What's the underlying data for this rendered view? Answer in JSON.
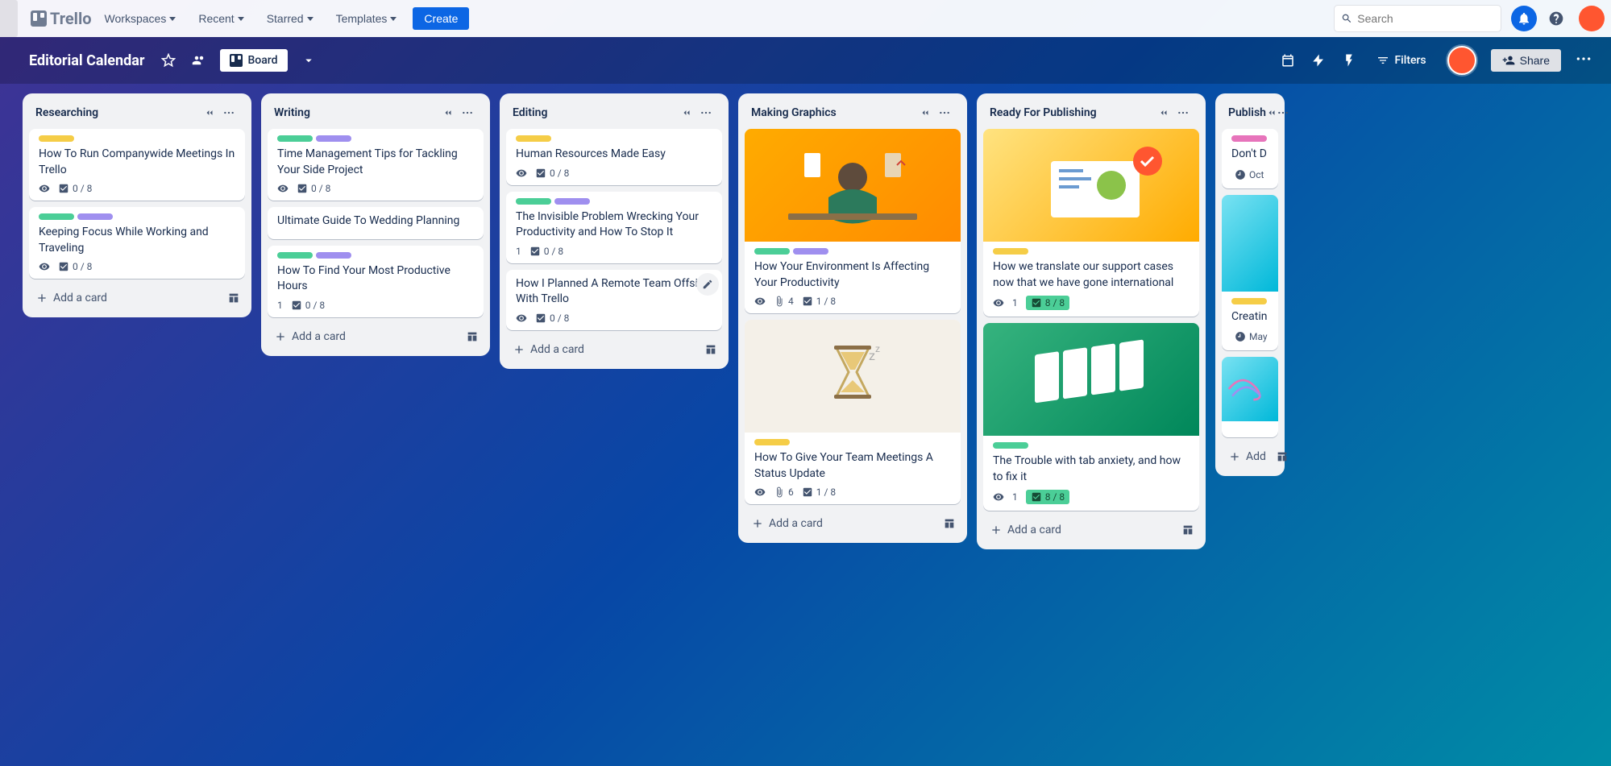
{
  "nav": {
    "logo_text": "Trello",
    "workspaces": "Workspaces",
    "recent": "Recent",
    "starred": "Starred",
    "templates": "Templates",
    "create": "Create",
    "search_placeholder": "Search"
  },
  "board_header": {
    "name": "Editorial Calendar",
    "board_view": "Board",
    "filters": "Filters",
    "share": "Share"
  },
  "lists": [
    {
      "title": "Researching",
      "add_card": "Add a card",
      "cards": [
        {
          "labels": [
            "yellow"
          ],
          "title": "How To Run Companywide Meetings In Trello",
          "badges": {
            "eye": true,
            "checklist": "0 / 8"
          }
        },
        {
          "labels": [
            "green",
            "purple"
          ],
          "title": "Keeping Focus While Working and Traveling",
          "badges": {
            "eye": true,
            "checklist": "0 / 8"
          }
        }
      ]
    },
    {
      "title": "Writing",
      "add_card": "Add a card",
      "cards": [
        {
          "labels": [
            "green",
            "purple"
          ],
          "title": "Time Management Tips for Tackling Your Side Project",
          "badges": {
            "eye": true,
            "checklist": "0 / 8"
          }
        },
        {
          "labels": [],
          "title": "Ultimate Guide To Wedding Planning",
          "badges": {}
        },
        {
          "labels": [
            "green",
            "purple"
          ],
          "title": "How To Find Your Most Productive Hours",
          "badges": {
            "num": "1",
            "checklist": "0 / 8"
          }
        }
      ]
    },
    {
      "title": "Editing",
      "add_card": "Add a card",
      "cards": [
        {
          "labels": [
            "yellow"
          ],
          "title": "Human Resources Made Easy",
          "badges": {
            "eye": true,
            "checklist": "0 / 8"
          }
        },
        {
          "labels": [
            "green",
            "purple"
          ],
          "title": "The Invisible Problem Wrecking Your Productivity and How To Stop It",
          "badges": {
            "num": "1",
            "checklist": "0 / 8"
          }
        },
        {
          "labels": [],
          "title": "How I Planned A Remote Team Offsite With Trello",
          "badges": {
            "eye": true,
            "checklist": "0 / 8"
          },
          "edit_icon": true
        }
      ]
    },
    {
      "title": "Making Graphics",
      "add_card": "Add a card",
      "cards": [
        {
          "cover": "orange-meditate",
          "labels": [
            "green",
            "purple"
          ],
          "title": "How Your Environment Is Affecting Your Productivity",
          "badges": {
            "eye": true,
            "attach": "4",
            "checklist": "1 / 8"
          }
        },
        {
          "cover": "hourglass",
          "labels": [
            "yellow"
          ],
          "title": "How To Give Your Team Meetings A Status Update",
          "badges": {
            "eye": true,
            "attach": "6",
            "checklist": "1 / 8"
          }
        }
      ]
    },
    {
      "title": "Ready For Publishing",
      "add_card": "Add a card",
      "cards": [
        {
          "cover": "yellow-support",
          "labels": [
            "yellow"
          ],
          "title": "How we translate our support cases now that we have gone international",
          "badges": {
            "eye": true,
            "num": "1",
            "checklist_complete": "8 / 8"
          }
        },
        {
          "cover": "green-tabs",
          "labels": [
            "green"
          ],
          "title": "The Trouble with tab anxiety, and how to fix it",
          "badges": {
            "eye": true,
            "num": "1",
            "checklist_complete": "8 / 8"
          }
        }
      ]
    },
    {
      "title": "Publish",
      "add_card": "Add",
      "narrow": true,
      "cards": [
        {
          "labels": [
            "pink"
          ],
          "title": "Don't D",
          "badges": {
            "clock": true,
            "date": "Oct"
          }
        },
        {
          "cover": "teal",
          "labels": [
            "yellow"
          ],
          "title": "Creatin",
          "badges": {
            "clock": true,
            "date": "May"
          }
        },
        {
          "cover": "teal-swirl",
          "labels": [],
          "title": "",
          "badges": {}
        }
      ]
    }
  ]
}
